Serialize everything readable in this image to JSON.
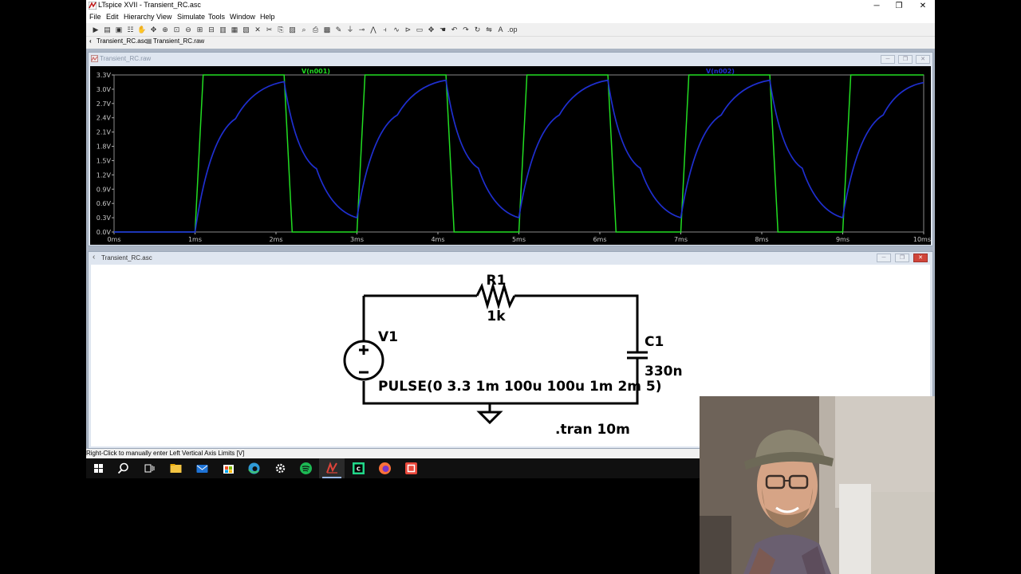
{
  "window": {
    "title": "LTspice XVII - Transient_RC.asc",
    "controls": {
      "minimize": "─",
      "restore": "❐",
      "close": "✕"
    }
  },
  "menu": [
    "File",
    "Edit",
    "Hierarchy",
    "View",
    "Simulate",
    "Tools",
    "Window",
    "Help"
  ],
  "toolbar_icons": [
    "run",
    "open",
    "save",
    "control-panel",
    "halt",
    "pan",
    "zoom-in",
    "zoom-area",
    "zoom-out",
    "zoom-full",
    "autoscale",
    "tile-horizontal",
    "tile-vertical",
    "cascade",
    "close-window",
    "cut",
    "copy",
    "paste",
    "find",
    "print",
    "print-preview",
    "draw-wire",
    "ground",
    "label-net",
    "resistor",
    "capacitor",
    "inductor",
    "diode",
    "component",
    "move",
    "drag",
    "undo",
    "redo",
    "rotate",
    "mirror",
    "text",
    "spice-directive"
  ],
  "doc_tabs": [
    "Transient_RC.asc",
    "Transient_RC.raw"
  ],
  "plot_window": {
    "title": "Transient_RC.raw",
    "controls": [
      "─",
      "❐",
      "✕"
    ],
    "traces": [
      {
        "label": "V(n001)",
        "color": "#22dd22"
      },
      {
        "label": "V(n002)",
        "color": "#1f2fd0"
      }
    ],
    "y_ticks": [
      "3.3V",
      "3.0V",
      "2.7V",
      "2.4V",
      "2.1V",
      "1.8V",
      "1.5V",
      "1.2V",
      "0.9V",
      "0.6V",
      "0.3V",
      "0.0V"
    ],
    "x_ticks": [
      "0ms",
      "1ms",
      "2ms",
      "3ms",
      "4ms",
      "5ms",
      "6ms",
      "7ms",
      "8ms",
      "9ms",
      "10ms"
    ]
  },
  "chart_data": {
    "type": "line",
    "x_unit": "ms",
    "y_unit": "V",
    "xlim": [
      0,
      10
    ],
    "ylim": [
      0,
      3.3
    ],
    "background": "#000000",
    "series": [
      {
        "name": "V(n001)",
        "color": "#22dd22",
        "x": [
          0,
          1,
          1.1,
          2.1,
          2.2,
          3,
          3.1,
          4.1,
          4.2,
          5,
          5.1,
          6.1,
          6.2,
          7,
          7.1,
          8.1,
          8.2,
          9,
          9.1,
          10
        ],
        "y": [
          0,
          0,
          3.3,
          3.3,
          0,
          0,
          3.3,
          3.3,
          0,
          0,
          3.3,
          3.3,
          0,
          0,
          3.3,
          3.3,
          0,
          0,
          3.3,
          3.3
        ]
      },
      {
        "name": "V(n002)",
        "color": "#1f2fd0",
        "x": [
          0,
          1,
          1.5,
          2.1,
          2.5,
          3,
          3.5,
          4.1,
          4.5,
          5,
          5.5,
          6.1,
          6.5,
          7,
          7.5,
          8.1,
          8.5,
          9,
          9.5,
          10
        ],
        "y": [
          0,
          0,
          2.38,
          3.16,
          1.33,
          0.3,
          2.46,
          3.19,
          1.34,
          0.3,
          2.46,
          3.19,
          1.34,
          0.3,
          2.46,
          3.19,
          1.34,
          0.3,
          2.46,
          3.14
        ]
      }
    ]
  },
  "schematic_window": {
    "title": "Transient_RC.asc",
    "controls": [
      "─",
      "❐",
      "✕"
    ],
    "components": {
      "r1_name": "R1",
      "r1_value": "1k",
      "v1_name": "V1",
      "v1_value": "PULSE(0 3.3 1m 100u 100u 1m 2m 5)",
      "c1_name": "C1",
      "c1_value": "330n"
    },
    "directive": ".tran 10m"
  },
  "status_bar": "Right-Click to manually enter Left Vertical Axis Limits [V]",
  "taskbar_icons": [
    "windows-start-icon",
    "search-icon",
    "task-view-icon",
    "file-explorer-icon",
    "mail-icon",
    "store-icon",
    "edge-icon",
    "settings-icon",
    "spotify-icon",
    "ltspice-icon",
    "clion-icon",
    "firefox-icon",
    "app-icon"
  ]
}
